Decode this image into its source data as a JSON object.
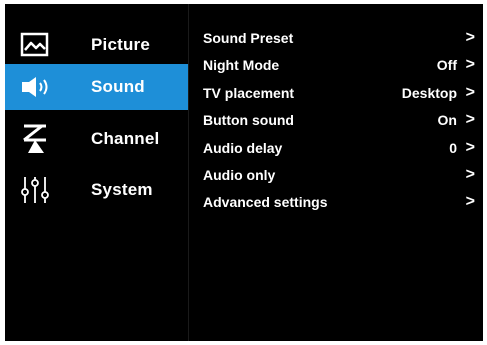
{
  "sidebar": {
    "items": [
      {
        "label": "Picture",
        "icon": "picture-icon",
        "active": false
      },
      {
        "label": "Sound",
        "icon": "speaker-icon",
        "active": true
      },
      {
        "label": "Channel",
        "icon": "antenna-icon",
        "active": false
      },
      {
        "label": "System",
        "icon": "sliders-icon",
        "active": false
      }
    ]
  },
  "settings": {
    "rows": [
      {
        "label": "Sound Preset",
        "value": "",
        "chevron": ">"
      },
      {
        "label": "Night Mode",
        "value": "Off",
        "chevron": ">"
      },
      {
        "label": "TV placement",
        "value": "Desktop",
        "chevron": ">"
      },
      {
        "label": "Button sound",
        "value": "On",
        "chevron": ">"
      },
      {
        "label": "Audio delay",
        "value": "0",
        "chevron": ">"
      },
      {
        "label": "Audio only",
        "value": "",
        "chevron": ">"
      },
      {
        "label": "Advanced settings",
        "value": "",
        "chevron": ">"
      }
    ]
  },
  "colors": {
    "background": "#000000",
    "active_highlight": "#1e8fd8",
    "text": "#ffffff"
  }
}
